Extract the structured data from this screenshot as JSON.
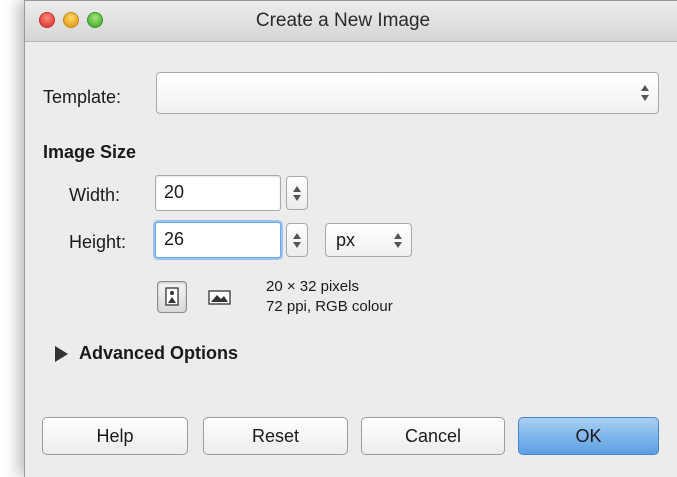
{
  "window": {
    "title": "Create a New Image"
  },
  "template": {
    "label": "Template:",
    "value": ""
  },
  "image_size": {
    "heading": "Image Size",
    "width": {
      "label": "Width:",
      "value": "20"
    },
    "height": {
      "label": "Height:",
      "value": "26"
    },
    "unit": "px",
    "info_line1": "20 × 32 pixels",
    "info_line2": "72 ppi, RGB colour"
  },
  "advanced": {
    "label": "Advanced Options"
  },
  "buttons": {
    "help": "Help",
    "reset": "Reset",
    "cancel": "Cancel",
    "ok": "OK"
  },
  "icons": {
    "close": "close-icon",
    "minimize": "minimize-icon",
    "zoom": "zoom-icon",
    "portrait": "portrait-icon",
    "landscape": "landscape-icon",
    "disclosure": "disclosure-triangle-icon"
  },
  "colors": {
    "accent": "#5c9fe3",
    "focus_ring": "#9cc3ef",
    "window_bg": "#ececec"
  }
}
